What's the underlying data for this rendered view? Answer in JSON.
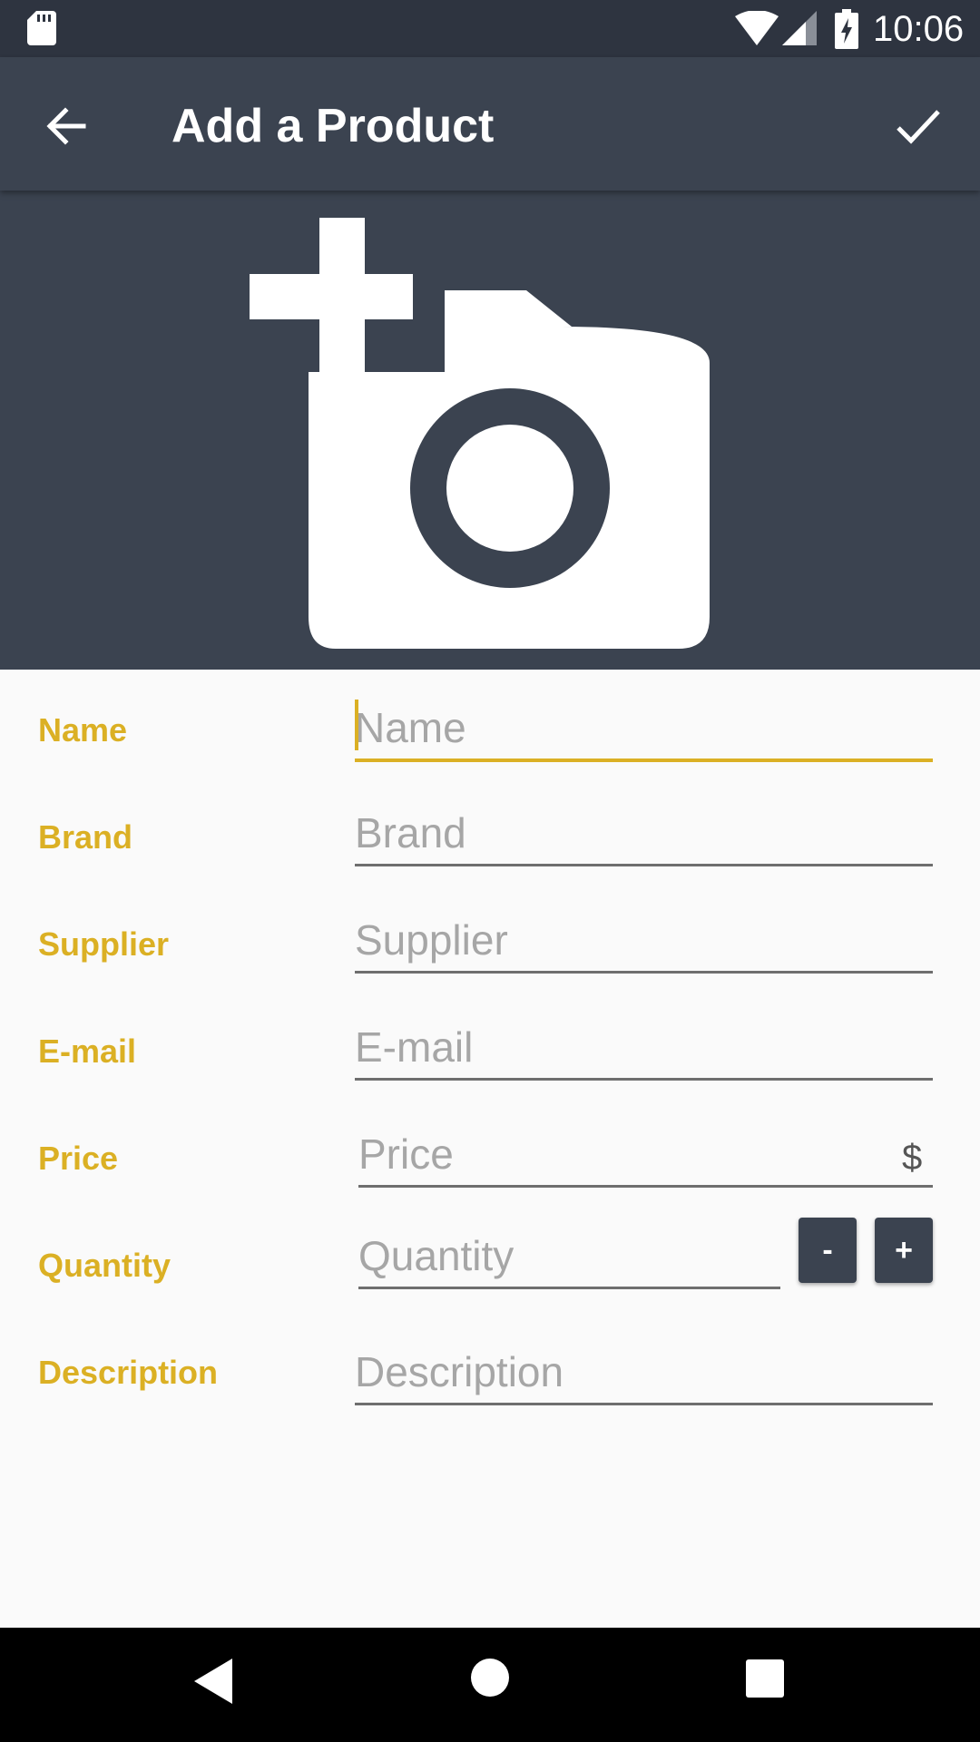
{
  "status_bar": {
    "time": "10:06"
  },
  "app_bar": {
    "title": "Add a Product",
    "back_icon": "arrow-back-icon",
    "save_icon": "check-icon"
  },
  "image_picker": {
    "icon": "add-a-photo-icon"
  },
  "form": {
    "name": {
      "label": "Name",
      "placeholder": "Name",
      "value": ""
    },
    "brand": {
      "label": "Brand",
      "placeholder": "Brand",
      "value": ""
    },
    "supplier": {
      "label": "Supplier",
      "placeholder": "Supplier",
      "value": ""
    },
    "email": {
      "label": "E-mail",
      "placeholder": "E-mail",
      "value": ""
    },
    "price": {
      "label": "Price",
      "placeholder": "Price",
      "value": "",
      "currency": "$"
    },
    "quantity": {
      "label": "Quantity",
      "placeholder": "Quantity",
      "value": "",
      "decrement": "-",
      "increment": "+"
    },
    "description": {
      "label": "Description",
      "placeholder": "Description",
      "value": ""
    }
  },
  "colors": {
    "accent": "#dbb024",
    "primary": "#3b4350",
    "status_bar": "#2e3440",
    "background": "#fafafa"
  }
}
